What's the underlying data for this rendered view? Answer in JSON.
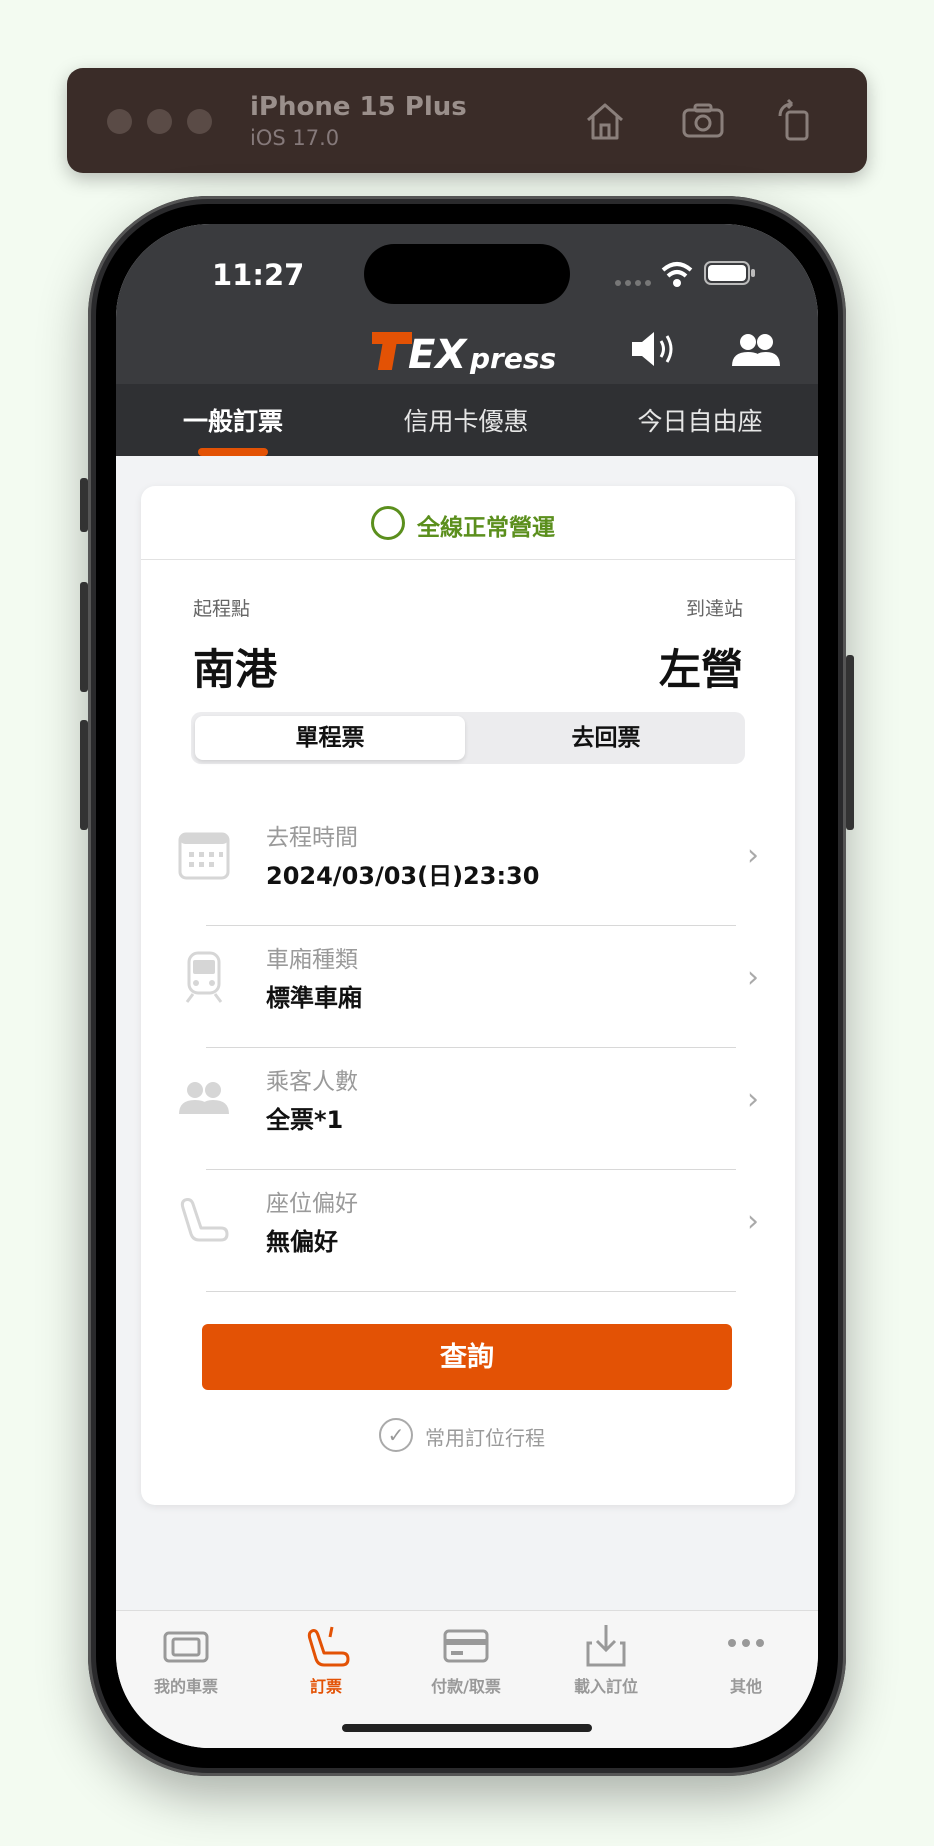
{
  "simulator": {
    "device": "iPhone 15 Plus",
    "os": "iOS 17.0"
  },
  "status_bar": {
    "time": "11:27"
  },
  "header": {
    "logo_text": "TEXpress"
  },
  "top_tabs": [
    {
      "label": "一般訂票",
      "active": true
    },
    {
      "label": "信用卡優惠",
      "active": false
    },
    {
      "label": "今日自由座",
      "active": false
    }
  ],
  "card": {
    "operation_status": "全線正常營運",
    "origin_label": "起程點",
    "destination_label": "到達站",
    "origin": "南港",
    "destination": "左營",
    "trip_types": [
      {
        "label": "單程票",
        "selected": true
      },
      {
        "label": "去回票",
        "selected": false
      }
    ],
    "rows": [
      {
        "icon": "calendar-icon",
        "label": "去程時間",
        "value": "2024/03/03(日)23:30"
      },
      {
        "icon": "train-icon",
        "label": "車廂種類",
        "value": "標準車廂"
      },
      {
        "icon": "passengers-icon",
        "label": "乘客人數",
        "value": "全票*1"
      },
      {
        "icon": "seat-icon",
        "label": "座位偏好",
        "value": "無偏好"
      }
    ],
    "search_label": "查詢",
    "favorite_label": "常用訂位行程"
  },
  "bottom_tabs": [
    {
      "icon": "ticket-icon",
      "label": "我的車票",
      "active": false
    },
    {
      "icon": "seat-booking-icon",
      "label": "訂票",
      "active": true
    },
    {
      "icon": "card-icon",
      "label": "付款/取票",
      "active": false
    },
    {
      "icon": "download-icon",
      "label": "載入訂位",
      "active": false
    },
    {
      "icon": "more-icon",
      "label": "其他",
      "active": false
    }
  ],
  "colors": {
    "accent": "#e35205",
    "header_bg": "#3a3b3e",
    "status_ok": "#5b8f1d"
  }
}
